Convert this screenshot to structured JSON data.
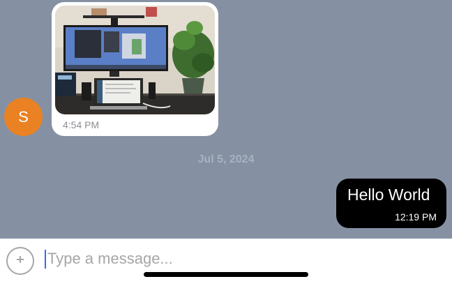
{
  "sender": {
    "avatar_initial": "S",
    "avatar_color": "#ea8122"
  },
  "messages": [
    {
      "type": "image",
      "direction": "incoming",
      "image_description": "desk setup with monitor, laptop and plant",
      "time": "4:54 PM"
    },
    {
      "type": "text",
      "direction": "outgoing",
      "text": "Hello World",
      "time": "12:19 PM"
    }
  ],
  "date_separator": "Jul 5, 2024",
  "composer": {
    "placeholder": "Type a message..."
  },
  "colors": {
    "chat_background": "#8591a3",
    "outgoing_bubble": "#000000",
    "incoming_bubble": "#ffffff",
    "cursor": "#2f6bff"
  },
  "icons": {
    "add": "plus-circle-icon"
  }
}
